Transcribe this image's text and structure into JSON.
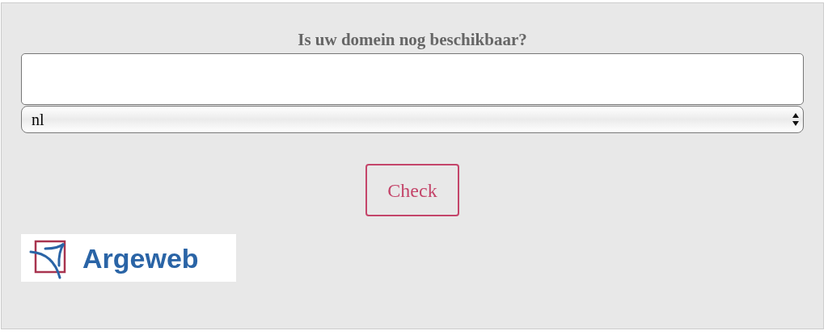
{
  "title": "Is uw domein nog beschikbaar?",
  "extension_select": {
    "value": "nl"
  },
  "check_button": {
    "label": "Check"
  },
  "logo": {
    "text": "Argeweb"
  }
}
